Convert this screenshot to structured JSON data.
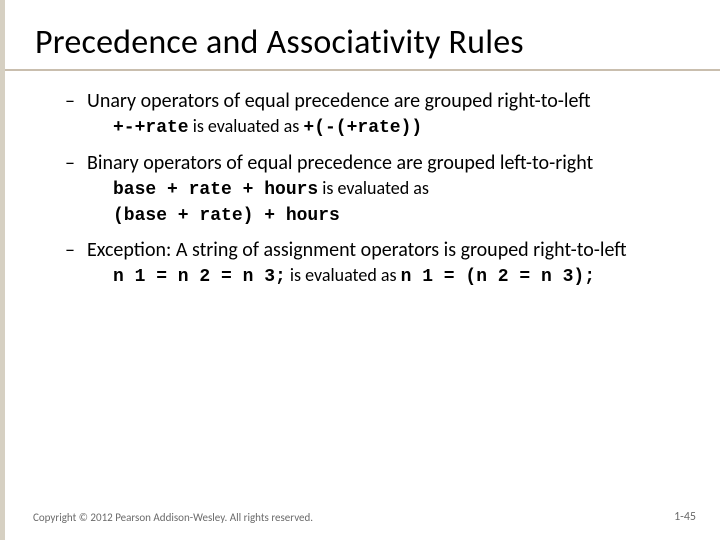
{
  "title": "Precedence and Associativity Rules",
  "bullets": [
    {
      "text": "Unary operators of equal precedence are grouped right-to-left",
      "sub": {
        "code1": "+-+rate",
        "mid": " is evaluated as ",
        "code2": "+(-(+rate))"
      }
    },
    {
      "text": "Binary operators of equal precedence are grouped left-to-right",
      "sub": {
        "code1": "base + rate + hours",
        "mid": " is evaluated as",
        "br": true,
        "code2": "(base + rate) + hours"
      }
    },
    {
      "text": "Exception:  A string of assignment operators is grouped right-to-left",
      "sub": {
        "code1": "n 1 = n 2 = n 3;",
        "mid": " is evaluated as ",
        "code2": "n 1 = (n 2 = n 3);"
      }
    }
  ],
  "footer": "Copyright © 2012 Pearson Addison-Wesley. All rights reserved.",
  "page": "1-45",
  "dash": "–"
}
